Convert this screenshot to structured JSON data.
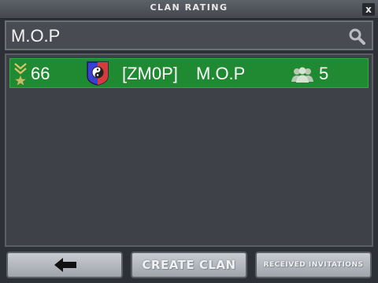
{
  "window": {
    "title": "CLAN RATING",
    "close_label": "x"
  },
  "search": {
    "value": "M.O.P",
    "icon": "search-icon"
  },
  "clans": [
    {
      "rating": "66",
      "tag": "[ZM0P]",
      "name": "M.O.P",
      "members": "5",
      "rank_icon": "rank-chevron-star-icon",
      "emblem_icon": "yin-yang-shield-icon",
      "members_icon": "members-icon",
      "row_color": "#1f8a31"
    }
  ],
  "footer": {
    "back_icon": "arrow-left-icon",
    "create_label": "CREATE CLAN",
    "invitations_label": "RECEIVED INVITATIONS"
  }
}
